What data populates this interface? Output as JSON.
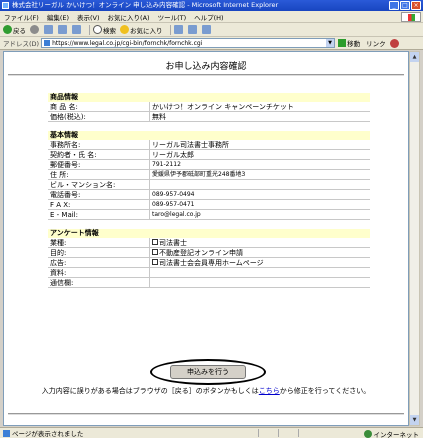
{
  "window": {
    "title": "株式会社リーガル かいけつ！オンライン 申し込み内容確認 - Microsoft Internet Explorer"
  },
  "menu": [
    "ファイル(F)",
    "編集(E)",
    "表示(V)",
    "お気に入り(A)",
    "ツール(T)",
    "ヘルプ(H)"
  ],
  "toolbar": {
    "back": "戻る",
    "search": "検索",
    "favorites": "お気に入り"
  },
  "address": {
    "label": "アドレス(D)",
    "url": "https://www.legal.co.jp/cgi-bin/fornchk/fornchk.cgi",
    "go": "移動",
    "links": "リンク"
  },
  "page": {
    "title": "お申し込み内容確認",
    "sections": [
      {
        "heading": "商品情報",
        "rows": [
          {
            "label": "商 品 名:",
            "value": "かいけつ！オンライン キャンペーンチケット"
          },
          {
            "label": "価格(税込):",
            "value": "無料"
          }
        ]
      },
      {
        "heading": "基本情報",
        "rows": [
          {
            "label": "事務所名:",
            "value": "リーガル司法書士事務所"
          },
          {
            "label": "契約者・氏 名:",
            "value": "リーガル太郎"
          },
          {
            "label": "郵便番号:",
            "value": "791-2112"
          },
          {
            "label": "住  所:",
            "value": "愛媛県伊予郡砥部町重光248番地3"
          },
          {
            "label": "ビル・マンション名:",
            "value": ""
          },
          {
            "label": "電話番号:",
            "value": "089-957-0494"
          },
          {
            "label": "F A X:",
            "value": "089-957-0471"
          },
          {
            "label": "E - Mail:",
            "value": "taro@legal.co.jp"
          }
        ]
      },
      {
        "heading": "アンケート情報",
        "rows": [
          {
            "label": "業種:",
            "value": "司法書士",
            "checkbox": true
          },
          {
            "label": "目的:",
            "value": "不動産登記オンライン申請",
            "checkbox": true
          },
          {
            "label": "広告:",
            "value": "司法書士会会員専用ホームページ",
            "checkbox": true
          },
          {
            "label": "資料:",
            "value": ""
          },
          {
            "label": "通信欄:",
            "value": ""
          }
        ]
      }
    ],
    "submit_label": "申込みを行う",
    "note_before": "入力内容に誤りがある場合はブラウザの［戻る］のボタンかもしくは",
    "note_link": "こちら",
    "note_after": "から修正を行ってください。"
  },
  "status": {
    "text": "ページが表示されました",
    "zone": "インターネット"
  }
}
